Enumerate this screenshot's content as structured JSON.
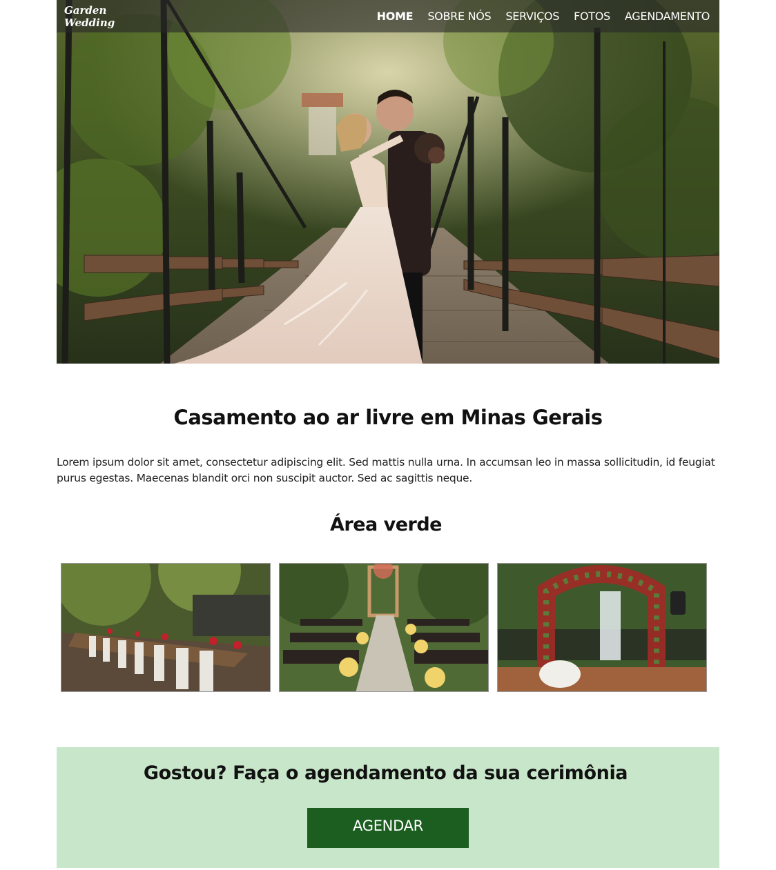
{
  "brand": {
    "logo_line1": "Garden",
    "logo_line2": "Wedding"
  },
  "nav": {
    "items": [
      {
        "label": "HOME",
        "active": true
      },
      {
        "label": "SOBRE NÓS",
        "active": false
      },
      {
        "label": "SERVIÇOS",
        "active": false
      },
      {
        "label": "FOTOS",
        "active": false
      },
      {
        "label": "AGENDAMENTO",
        "active": false
      }
    ]
  },
  "hero": {
    "image": "wedding-couple-on-bridge"
  },
  "main": {
    "headline": "Casamento ao ar livre em Minas Gerais",
    "intro": "Lorem ipsum dolor sit amet, consectetur adipiscing elit. Sed mattis nulla urna. In accumsan leo in massa sollicitudin, id feugiat purus egestas. Maecenas blandit orci non suscipit auctor. Sed ac sagittis neque."
  },
  "gallery": {
    "title": "Área verde",
    "photos": [
      {
        "image": "outdoor-banquet-table"
      },
      {
        "image": "garden-ceremony-benches"
      },
      {
        "image": "floral-ceremony-arch"
      }
    ]
  },
  "cta": {
    "title": "Gostou? Faça o agendamento da sua cerimônia",
    "button_label": "AGENDAR"
  },
  "colors": {
    "cta_background": "#c8e6c9",
    "cta_button": "#1b5e20",
    "nav_overlay": "#282828"
  }
}
